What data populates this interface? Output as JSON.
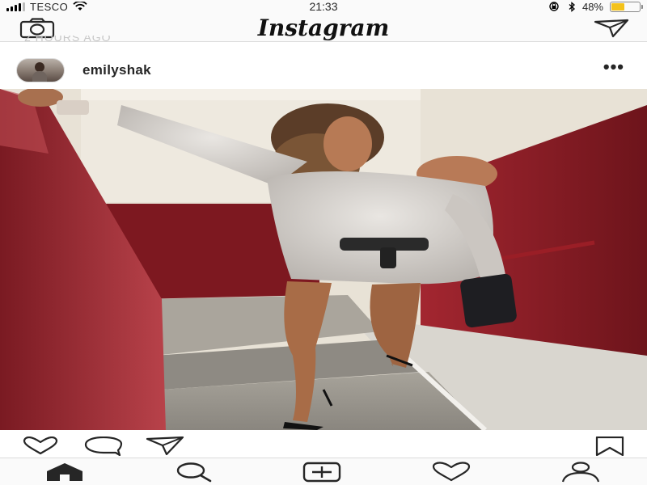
{
  "status_bar": {
    "carrier": "TESCO",
    "time": "21:33",
    "battery_percent": "48%",
    "battery_level": 0.48,
    "battery_color": "#f4c21a"
  },
  "nav": {
    "logo": "Instagram",
    "left_icon": "camera-icon",
    "right_icon": "direct-message-icon"
  },
  "previous_caption": "2 HOURS AGO",
  "post": {
    "username": "emilyshak",
    "more_label": "•••",
    "image_alt": "post-photo"
  },
  "actions": {
    "like_icon": "heart-icon",
    "comment_icon": "comment-icon",
    "share_icon": "send-icon",
    "save_icon": "bookmark-icon"
  },
  "tabs": [
    {
      "icon": "home-icon",
      "active": true
    },
    {
      "icon": "search-icon",
      "active": false
    },
    {
      "icon": "add-post-icon",
      "active": false
    },
    {
      "icon": "activity-heart-icon",
      "active": false
    },
    {
      "icon": "profile-icon",
      "active": false
    }
  ],
  "colors": {
    "text": "#262626",
    "border": "#dbdbdb",
    "bar_bg": "#fafafa",
    "wall_red": "#8a1c24"
  }
}
